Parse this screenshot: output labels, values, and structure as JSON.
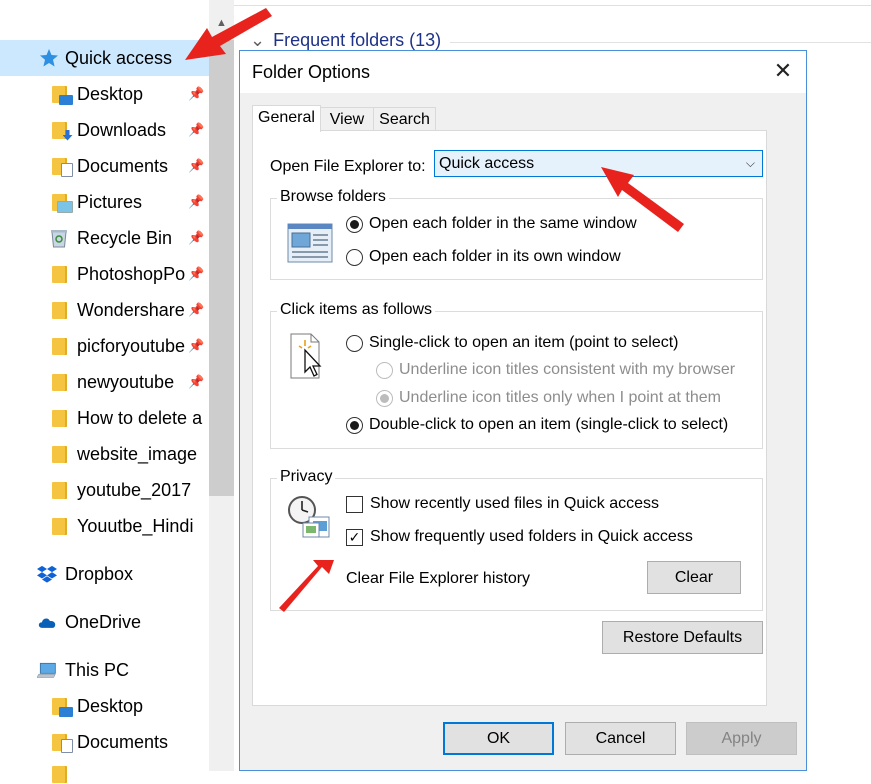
{
  "navigation": {
    "items": [
      {
        "label": "Quick access",
        "icon": "pin-star-icon",
        "pinned": false,
        "selected": true
      },
      {
        "label": "Desktop",
        "icon": "folder-desktop-icon",
        "pinned": true
      },
      {
        "label": "Downloads",
        "icon": "folder-download-icon",
        "pinned": true
      },
      {
        "label": "Documents",
        "icon": "folder-documents-icon",
        "pinned": true
      },
      {
        "label": "Pictures",
        "icon": "folder-pictures-icon",
        "pinned": true
      },
      {
        "label": "Recycle Bin",
        "icon": "recycle-bin-icon",
        "pinned": true
      },
      {
        "label": "PhotoshopPo",
        "icon": "folder-icon",
        "pinned": true
      },
      {
        "label": "Wondershare",
        "icon": "folder-icon",
        "pinned": true
      },
      {
        "label": "picforyoutube",
        "icon": "folder-icon",
        "pinned": true
      },
      {
        "label": "newyoutube",
        "icon": "folder-icon",
        "pinned": true
      },
      {
        "label": "How to delete a",
        "icon": "folder-icon",
        "pinned": false
      },
      {
        "label": "website_image",
        "icon": "folder-icon",
        "pinned": false
      },
      {
        "label": "youtube_2017",
        "icon": "folder-icon",
        "pinned": false
      },
      {
        "label": "Youutbe_Hindi",
        "icon": "folder-icon",
        "pinned": false
      },
      {
        "label": "Dropbox",
        "icon": "dropbox-icon",
        "pinned": false
      },
      {
        "label": "OneDrive",
        "icon": "onedrive-cloud-icon",
        "pinned": false
      },
      {
        "label": "This PC",
        "icon": "computer-icon",
        "pinned": false
      },
      {
        "label": "Desktop",
        "icon": "folder-desktop-icon",
        "pinned": false
      },
      {
        "label": "Documents",
        "icon": "folder-documents-icon",
        "pinned": false
      }
    ]
  },
  "main": {
    "section_header": "Frequent folders (13)"
  },
  "dialog": {
    "title": "Folder Options",
    "tabs": [
      "General",
      "View",
      "Search"
    ],
    "active_tab": "General",
    "open_explorer": {
      "label": "Open File Explorer to:",
      "value": "Quick access"
    },
    "browse_folders": {
      "title": "Browse folders",
      "options": [
        {
          "label": "Open each folder in the same window",
          "checked": true
        },
        {
          "label": "Open each folder in its own window",
          "checked": false
        }
      ]
    },
    "click_items": {
      "title": "Click items as follows",
      "single_click": {
        "label": "Single-click to open an item (point to select)",
        "checked": false
      },
      "underline_browser": {
        "label": "Underline icon titles consistent with my browser",
        "checked": false,
        "disabled": true
      },
      "underline_point": {
        "label": "Underline icon titles only when I point at them",
        "checked": true,
        "disabled": true
      },
      "double_click": {
        "label": "Double-click to open an item (single-click to select)",
        "checked": true
      }
    },
    "privacy": {
      "title": "Privacy",
      "recent_files": {
        "label": "Show recently used files in Quick access",
        "checked": false
      },
      "frequent_folders": {
        "label": "Show frequently used folders in Quick access",
        "checked": true
      },
      "clear_history_label": "Clear File Explorer history",
      "clear_button": "Clear"
    },
    "restore_defaults": "Restore Defaults",
    "buttons": {
      "ok": "OK",
      "cancel": "Cancel",
      "apply": "Apply"
    },
    "close_glyph": "✕"
  },
  "colors": {
    "selection": "#cce8ff",
    "accent": "#0078d7",
    "annotation_arrow": "#e8231d",
    "folder": "#f5c542"
  }
}
